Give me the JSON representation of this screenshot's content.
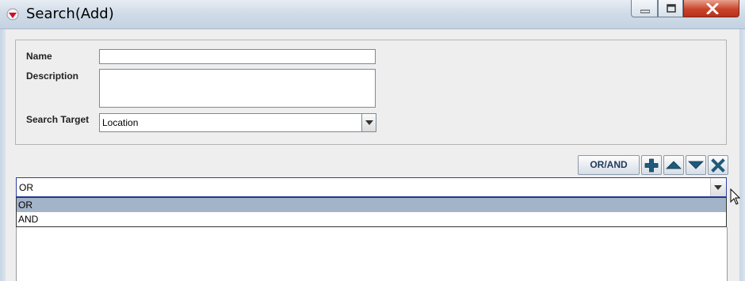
{
  "window": {
    "title": "Search(Add)",
    "app_icon": "red-diamond-icon",
    "controls": [
      "minimize-icon",
      "maximize-icon",
      "close-icon"
    ]
  },
  "form": {
    "name_label": "Name",
    "name_value": "",
    "description_label": "Description",
    "description_value": "",
    "search_target_label": "Search Target",
    "search_target_value": "Location"
  },
  "toolbar": {
    "or_and_label": "OR/AND",
    "icons": [
      "add-icon",
      "move-up-icon",
      "move-down-icon",
      "delete-icon"
    ]
  },
  "condition": {
    "selected": "OR",
    "options": [
      "OR",
      "AND"
    ],
    "highlighted_index": 0
  },
  "colors": {
    "accent": "#1f5a7a",
    "focus_border": "#2b3fa5",
    "selection": "#a4b4c8",
    "close_button": "#c9452a"
  }
}
